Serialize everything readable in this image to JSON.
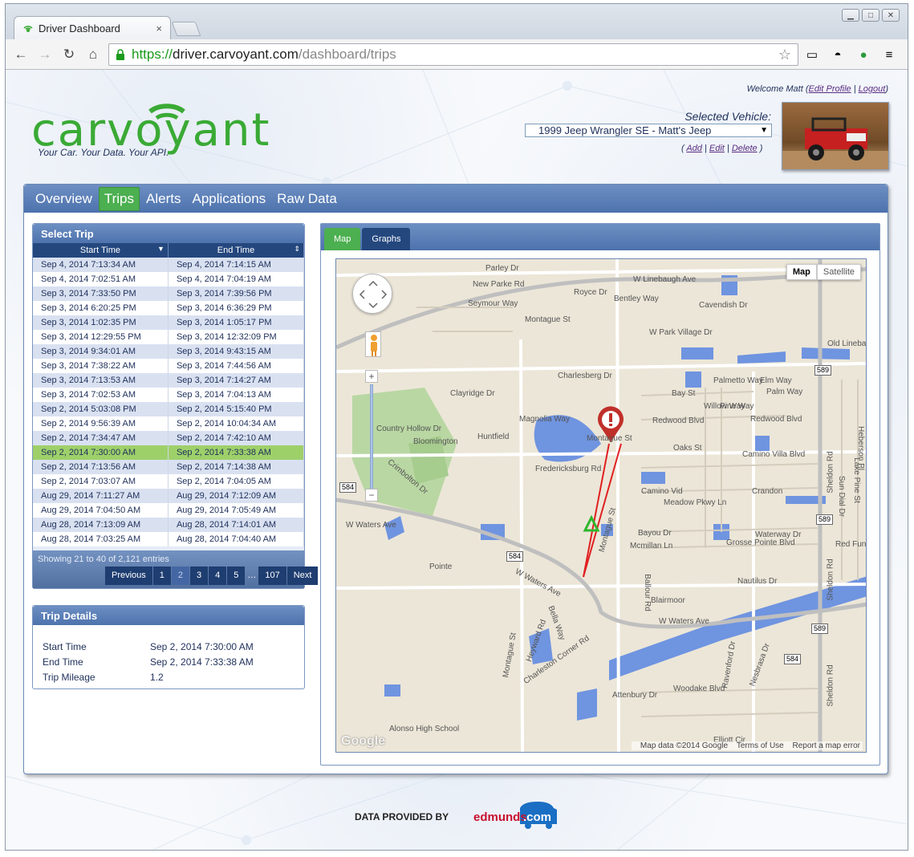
{
  "browser": {
    "tab_title": "Driver Dashboard",
    "tab_close": "×",
    "url_secure": "https://",
    "url_host": "driver.carvoyant.com",
    "url_path": "/dashboard/trips",
    "bookmark_star": "☆"
  },
  "header": {
    "welcome_prefix": "Welcome Matt (",
    "edit_profile": "Edit Profile",
    "separator": "|",
    "logout": "Logout",
    "welcome_suffix": ")",
    "logo_text": "carvoyant",
    "tagline": "Your Car. Your Data. Your API.",
    "selected_vehicle_label": "Selected Vehicle:",
    "selected_vehicle": "1999 Jeep Wrangler SE - Matt's Jeep",
    "vehicle_actions": {
      "open": "(",
      "add": "Add",
      "edit": "Edit",
      "delete": "Delete",
      "close": ")"
    }
  },
  "nav": {
    "items": [
      "Overview",
      "Trips",
      "Alerts",
      "Applications",
      "Raw Data"
    ],
    "active": "Trips"
  },
  "select_trip": {
    "title": "Select Trip",
    "columns": [
      "Start Time",
      "End Time"
    ],
    "rows": [
      [
        "Sep 4, 2014 7:13:34 AM",
        "Sep 4, 2014 7:14:15 AM"
      ],
      [
        "Sep 4, 2014 7:02:51 AM",
        "Sep 4, 2014 7:04:19 AM"
      ],
      [
        "Sep 3, 2014 7:33:50 PM",
        "Sep 3, 2014 7:39:56 PM"
      ],
      [
        "Sep 3, 2014 6:20:25 PM",
        "Sep 3, 2014 6:36:29 PM"
      ],
      [
        "Sep 3, 2014 1:02:35 PM",
        "Sep 3, 2014 1:05:17 PM"
      ],
      [
        "Sep 3, 2014 12:29:55 PM",
        "Sep 3, 2014 12:32:09 PM"
      ],
      [
        "Sep 3, 2014 9:34:01 AM",
        "Sep 3, 2014 9:43:15 AM"
      ],
      [
        "Sep 3, 2014 7:38:22 AM",
        "Sep 3, 2014 7:44:56 AM"
      ],
      [
        "Sep 3, 2014 7:13:53 AM",
        "Sep 3, 2014 7:14:27 AM"
      ],
      [
        "Sep 3, 2014 7:02:53 AM",
        "Sep 3, 2014 7:04:13 AM"
      ],
      [
        "Sep 2, 2014 5:03:08 PM",
        "Sep 2, 2014 5:15:40 PM"
      ],
      [
        "Sep 2, 2014 9:56:39 AM",
        "Sep 2, 2014 10:04:34 AM"
      ],
      [
        "Sep 2, 2014 7:34:47 AM",
        "Sep 2, 2014 7:42:10 AM"
      ],
      [
        "Sep 2, 2014 7:30:00 AM",
        "Sep 2, 2014 7:33:38 AM"
      ],
      [
        "Sep 2, 2014 7:13:56 AM",
        "Sep 2, 2014 7:14:38 AM"
      ],
      [
        "Sep 2, 2014 7:03:07 AM",
        "Sep 2, 2014 7:04:05 AM"
      ],
      [
        "Aug 29, 2014 7:11:27 AM",
        "Aug 29, 2014 7:12:09 AM"
      ],
      [
        "Aug 29, 2014 7:04:50 AM",
        "Aug 29, 2014 7:05:49 AM"
      ],
      [
        "Aug 28, 2014 7:13:09 AM",
        "Aug 28, 2014 7:14:01 AM"
      ],
      [
        "Aug 28, 2014 7:03:25 AM",
        "Aug 28, 2014 7:04:40 AM"
      ]
    ],
    "selected_row": 13,
    "showing": "Showing 21 to 40 of 2,121 entries",
    "pager": [
      "Previous",
      "1",
      "2",
      "3",
      "4",
      "5",
      "…",
      "107",
      "Next"
    ],
    "current_page": "2"
  },
  "trip_details": {
    "title": "Trip Details",
    "fields": [
      {
        "label": "Start Time",
        "value": "Sep 2, 2014 7:30:00 AM"
      },
      {
        "label": "End Time",
        "value": "Sep 2, 2014 7:33:38 AM"
      },
      {
        "label": "Trip Mileage",
        "value": "1.2"
      }
    ]
  },
  "map_panel": {
    "tabs": [
      "Map",
      "Graphs"
    ],
    "active_tab": "Map",
    "map_type": [
      "Map",
      "Satellite"
    ],
    "active_map_type": "Map",
    "footer": [
      "Map data ©2014 Google",
      "Terms of Use",
      "Report a map error"
    ],
    "google_logo": "Google",
    "zoom_in": "+",
    "zoom_out": "−",
    "labels": [
      "W Linebaugh Ave",
      "Royce Dr",
      "Parley Dr",
      "New Parke Rd",
      "Seymour Way",
      "Montague St",
      "Bentley Way",
      "W Park Village Dr",
      "Cavendish Dr",
      "Old Lineba",
      "Charlesberg Dr",
      "Clayridge Dr",
      "Palmetto Way",
      "Elm Way",
      "Palm Way",
      "Bay St",
      "Willow Way",
      "Pine Way",
      "Redwood Blvd",
      "Redwood Blvd",
      "Oaks St",
      "Camino Villa Blvd",
      "Country Hollow Dr",
      "Bloomington",
      "Huntfield",
      "Magnolia Way",
      "Montague St",
      "Fredericksburg Rd",
      "Camino Vid",
      "Meadow Pkwy Ln",
      "Crandon",
      "Bayou Dr",
      "Waterway Dr",
      "Mcmillan Ln",
      "Grosse Pointe Blvd",
      "W Waters Ave",
      "W Waters Ave",
      "W Waters Ave",
      "Sheldon Rd",
      "Sheldon Rd",
      "Sheldon Rd",
      "Ballour Rd",
      "Blairmoor",
      "Nautilus Dr",
      "Attenbury Dr",
      "Woodake Blvd",
      "Montague St",
      "Heyward Rd",
      "Bella Way",
      "Charleston Corner Rd",
      "Alonso High School",
      "Elliott Cir",
      "Ravenford Dr",
      "Nesbrasa Dr",
      "Lake Pine St",
      "Sun Dial Dr",
      "Red Fun D",
      "Pointe",
      "Heberson Pl",
      "Crimbolton Dr",
      "Montague St"
    ],
    "shields": [
      "589",
      "589",
      "584",
      "584",
      "589",
      "584",
      "589"
    ]
  },
  "footer": {
    "credit": "DATA PROVIDED BY",
    "edmunds": "edmunds",
    "edmunds_com": ".com"
  },
  "colors": {
    "brand_blue": "#4d72ad",
    "active_green": "#4caf50",
    "logo_green": "#3aaa35",
    "logo_navy": "#1e2f5a",
    "route_red": "#e02020"
  }
}
